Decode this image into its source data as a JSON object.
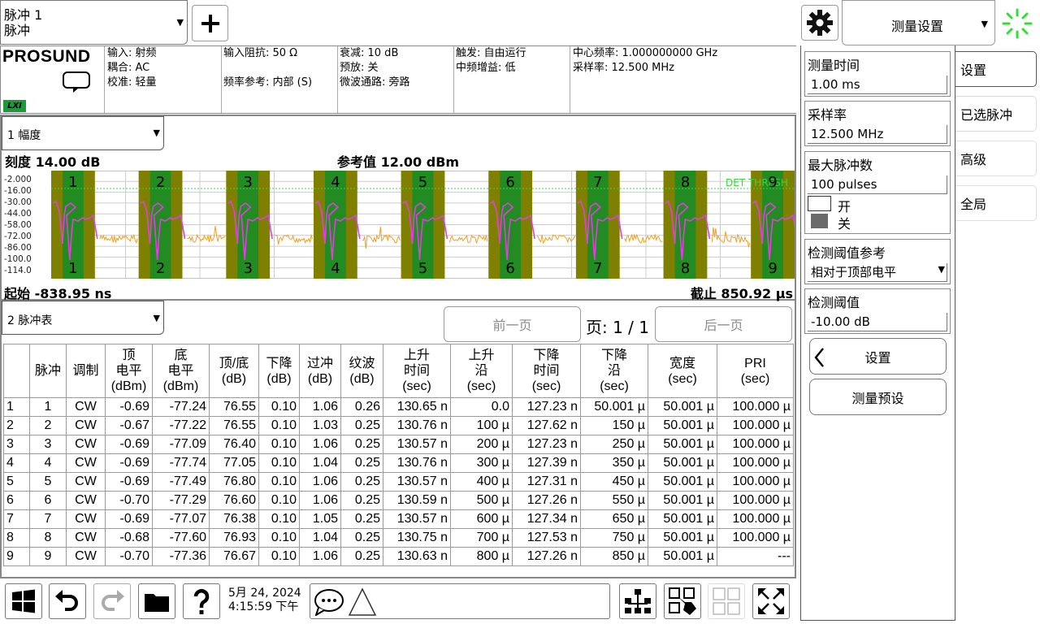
{
  "topbar": {
    "trace_name_line1": "脉冲 1",
    "trace_name_line2": "脉冲",
    "add_icon": "plus-icon",
    "settings_icon": "gear-icon",
    "menu_title": "测量设置",
    "status_icon": "spinner-icon"
  },
  "brand": {
    "logo": "PROSUND",
    "lxi": "LXI"
  },
  "info": {
    "col1": [
      "输入: 射频",
      "耦合: AC",
      "校准: 轻量"
    ],
    "col2": [
      "输入阻抗: 50 Ω",
      "",
      "频率参考: 内部 (S)"
    ],
    "col3": [
      "衰减: 10 dB",
      "预放: 关",
      "微波通路: 旁路"
    ],
    "col4": [
      "触发: 自由运行",
      "中频增益: 低"
    ],
    "col5": [
      "中心频率: 1.000000000 GHz",
      "采样率: 12.500 MHz"
    ]
  },
  "window1": {
    "mode": "1 幅度",
    "scale": "刻度 14.00 dB",
    "ref": "参考值 12.00 dBm",
    "start": "起始 -838.95 ns",
    "stop": "截止 850.92 µs",
    "threshold_label": "DET THRESH",
    "y_labels": [
      "-2.000",
      "-16.00",
      "-30.00",
      "-44.00",
      "-58.00",
      "-72.00",
      "-86.00",
      "-100.0",
      "-114.0"
    ],
    "pulse_labels": [
      "1",
      "2",
      "3",
      "4",
      "5",
      "6",
      "7",
      "8",
      "9"
    ],
    "colors": {
      "pulse_band": "#228b22",
      "pulse_edge": "#808000",
      "trace": "#e040e0",
      "noise": "#f0a020",
      "threshold": "#40d040"
    }
  },
  "window2": {
    "mode": "2 脉冲表",
    "prev_page": "前一页",
    "page": "页: 1 / 1",
    "next_page": "后一页",
    "headers": [
      "",
      "脉冲",
      "调制",
      "顶\n电平\n(dBm)",
      "底\n电平\n(dBm)",
      "顶/底\n(dB)",
      "下降\n(dB)",
      "过冲\n(dB)",
      "纹波\n(dB)",
      "上升\n时间\n(sec)",
      "上升\n沿\n(sec)",
      "下降\n时间\n(sec)",
      "下降\n沿\n(sec)",
      "宽度\n(sec)",
      "PRI\n(sec)"
    ],
    "rows": [
      [
        "1",
        "1",
        "CW",
        "-0.69",
        "-77.24",
        "76.55",
        "0.10",
        "1.06",
        "0.26",
        "130.65 n",
        "0.0",
        "127.23 n",
        "50.001 µ",
        "50.001 µ",
        "100.000 µ"
      ],
      [
        "2",
        "2",
        "CW",
        "-0.67",
        "-77.22",
        "76.55",
        "0.10",
        "1.03",
        "0.25",
        "130.76 n",
        "100 µ",
        "127.62 n",
        "150 µ",
        "50.001 µ",
        "100.000 µ"
      ],
      [
        "3",
        "3",
        "CW",
        "-0.69",
        "-77.09",
        "76.40",
        "0.10",
        "1.06",
        "0.25",
        "130.57 n",
        "200 µ",
        "127.23 n",
        "250 µ",
        "50.001 µ",
        "100.000 µ"
      ],
      [
        "4",
        "4",
        "CW",
        "-0.69",
        "-77.74",
        "77.05",
        "0.10",
        "1.04",
        "0.25",
        "130.76 n",
        "300 µ",
        "127.39 n",
        "350 µ",
        "50.001 µ",
        "100.000 µ"
      ],
      [
        "5",
        "5",
        "CW",
        "-0.69",
        "-77.49",
        "76.80",
        "0.10",
        "1.06",
        "0.25",
        "130.57 n",
        "400 µ",
        "127.31 n",
        "450 µ",
        "50.001 µ",
        "100.000 µ"
      ],
      [
        "6",
        "6",
        "CW",
        "-0.70",
        "-77.29",
        "76.60",
        "0.10",
        "1.06",
        "0.25",
        "130.59 n",
        "500 µ",
        "127.26 n",
        "550 µ",
        "50.001 µ",
        "100.000 µ"
      ],
      [
        "7",
        "7",
        "CW",
        "-0.69",
        "-77.07",
        "76.38",
        "0.10",
        "1.05",
        "0.25",
        "130.57 n",
        "600 µ",
        "127.34 n",
        "650 µ",
        "50.001 µ",
        "100.000 µ"
      ],
      [
        "8",
        "8",
        "CW",
        "-0.68",
        "-77.60",
        "76.93",
        "0.10",
        "1.04",
        "0.25",
        "130.75 n",
        "700 µ",
        "127.53 n",
        "750 µ",
        "50.001 µ",
        "100.000 µ"
      ],
      [
        "9",
        "9",
        "CW",
        "-0.70",
        "-77.36",
        "76.67",
        "0.10",
        "1.06",
        "0.25",
        "130.63 n",
        "800 µ",
        "127.26 n",
        "850 µ",
        "50.001 µ",
        "---"
      ]
    ]
  },
  "sidebar": {
    "meas_time": {
      "title": "测量时间",
      "value": "1.00 ms"
    },
    "sample_rate": {
      "title": "采样率",
      "value": "12.500 MHz"
    },
    "max_pulses": {
      "title": "最大脉冲数",
      "value": "100 pulses",
      "on": "开",
      "off": "关"
    },
    "thresh_ref": {
      "title": "检测阈值参考",
      "value": "相对于顶部电平"
    },
    "thresh": {
      "title": "检测阈值",
      "value": "-10.00 dB"
    },
    "back_btn": "设置",
    "preset_btn": "测量预设"
  },
  "tabs": [
    "设置",
    "已选脉冲",
    "高级",
    "全局"
  ],
  "taskbar": {
    "date": "5月 24, 2024",
    "time": "4:15:59 下午"
  }
}
